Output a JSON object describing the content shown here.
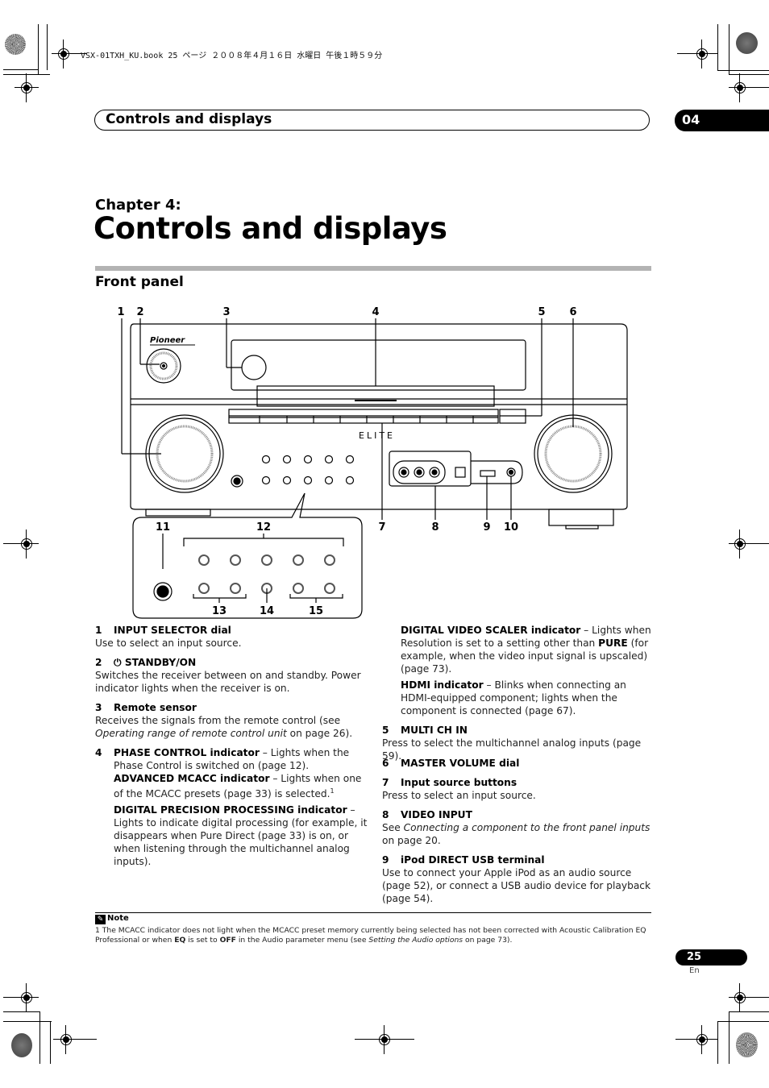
{
  "print_info": "VSX-01TXH_KU.book  25 ページ  ２００８年４月１６日  水曜日  午後１時５９分",
  "header": {
    "section_title": "Controls and displays",
    "chapter_number": "04"
  },
  "chapter": {
    "label": "Chapter 4:",
    "title": "Controls and displays"
  },
  "section": {
    "title": "Front panel"
  },
  "diagram": {
    "brand": "Pioneer",
    "sub_brand": "ELITE",
    "callouts": [
      "1",
      "2",
      "3",
      "4",
      "5",
      "6",
      "7",
      "8",
      "9",
      "10",
      "11",
      "12",
      "13",
      "14",
      "15"
    ]
  },
  "items": [
    {
      "num": "1",
      "title": "INPUT SELECTOR dial",
      "text": "Use to select an input source."
    },
    {
      "num": "2",
      "icon": "power-icon",
      "title": "STANDBY/ON",
      "text": "Switches the receiver between on and standby. Power indicator lights when the receiver is on."
    },
    {
      "num": "3",
      "title": "Remote sensor",
      "text": "Receives the signals from the remote control (see ",
      "ref": "Operating range of remote control unit",
      "text_after": " on page 26)."
    },
    {
      "num": "4",
      "subitems": [
        {
          "title": "PHASE CONTROL indicator",
          "text": " – Lights when the Phase Control is switched on (page 12)."
        },
        {
          "title": "ADVANCED MCACC indicator",
          "text": " – Lights when one of the MCACC presets (page 33) is selected.",
          "footnote": "1"
        },
        {
          "title": "DIGITAL PRECISION PROCESSING indicator",
          "text": " – Lights to indicate digital processing (for example, it disappears when Pure Direct (page 33) is on, or when listening through the multichannel analog inputs)."
        },
        {
          "title": "DIGITAL VIDEO SCALER indicator",
          "text": " – Lights when Resolution is set to a setting other than ",
          "bold": "PURE",
          "text_after": " (for example, when the video input signal is upscaled) (page 73)."
        },
        {
          "title": "HDMI indicator",
          "text": " – Blinks when connecting an HDMI-equipped component; lights when the component is connected (page 67)."
        }
      ]
    },
    {
      "num": "5",
      "title": "MULTI CH IN",
      "text": "Press to select the multichannel analog inputs (page 59)."
    },
    {
      "num": "6",
      "title": "MASTER VOLUME dial"
    },
    {
      "num": "7",
      "title": "Input source buttons",
      "text": "Press to select an input source."
    },
    {
      "num": "8",
      "title": "VIDEO INPUT",
      "text": "See ",
      "ref": "Connecting a component to the front panel inputs",
      "text_after": " on page 20."
    },
    {
      "num": "9",
      "title": "iPod DIRECT USB terminal",
      "text": "Use to connect your Apple iPod as an audio source (page 52), or connect a USB audio device for playback (page 54)."
    }
  ],
  "note": {
    "label": "Note",
    "text_1": "1 The MCACC indicator does not light when the MCACC preset memory currently being selected has not been corrected with Acoustic Calibration EQ Professional or when ",
    "bold_1": "EQ",
    "text_2": " is set to ",
    "bold_2": "OFF",
    "text_3": " in the Audio parameter menu (see ",
    "ref": "Setting the Audio options",
    "text_4": " on page 73)."
  },
  "footer": {
    "page_number": "25",
    "language": "En"
  }
}
